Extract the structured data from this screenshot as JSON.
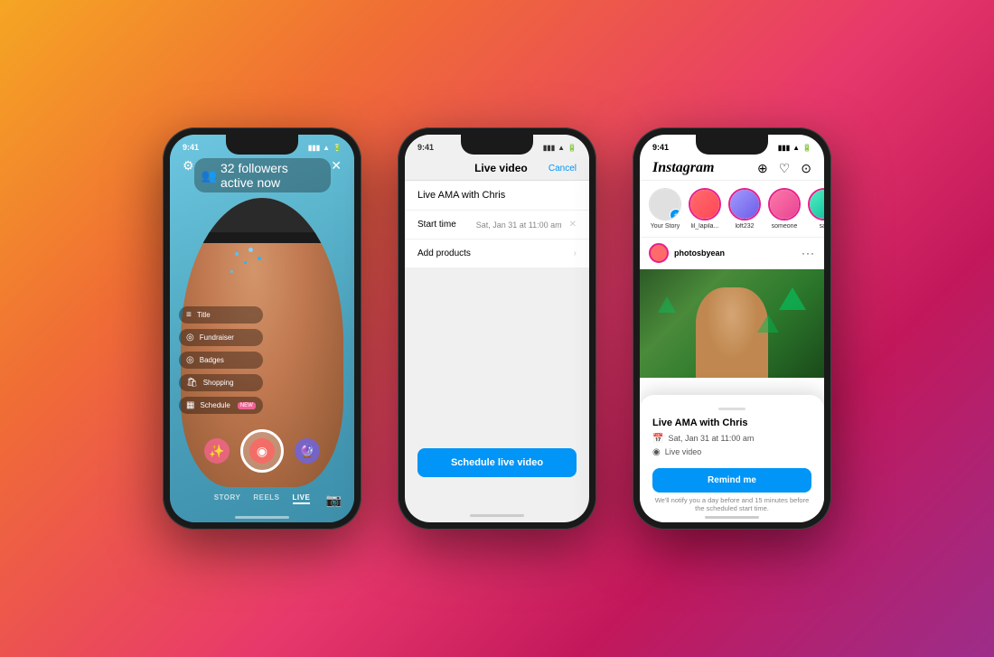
{
  "background": {
    "gradient": "linear-gradient(135deg, #f5a623 0%, #f06d35 25%, #e8396b 55%, #c2185b 75%, #9c2d8a 100%)"
  },
  "phone1": {
    "status_time": "9:41",
    "followers_text": "32 followers active now",
    "nav_items": [
      "STORY",
      "REELS",
      "LIVE"
    ],
    "active_nav": "LIVE",
    "menu_items": [
      {
        "icon": "≡",
        "label": "Title"
      },
      {
        "icon": "◎",
        "label": "Fundraiser"
      },
      {
        "icon": "◎",
        "label": "Badges"
      },
      {
        "icon": "◎",
        "label": "Shopping"
      },
      {
        "icon": "▦",
        "label": "Schedule",
        "new": true
      }
    ]
  },
  "phone2": {
    "status_time": "9:41",
    "header_title": "Live video",
    "header_cancel": "Cancel",
    "live_title": "Live AMA with Chris",
    "start_time_label": "Start time",
    "start_time_value": "Sat, Jan 31 at 11:00 am",
    "add_products_label": "Add products",
    "schedule_btn": "Schedule live video"
  },
  "phone3": {
    "status_time": "9:41",
    "insta_logo": "Instagram",
    "stories": [
      {
        "label": "Your Story",
        "type": "your"
      },
      {
        "label": "lil_lapila...",
        "color": "#e91e8c"
      },
      {
        "label": "loft232",
        "color": "#9c27b0"
      },
      {
        "label": "someone",
        "color": "#ff5722"
      },
      {
        "label": "sas",
        "color": "#2196f3"
      }
    ],
    "post_username": "photosbyean",
    "modal": {
      "title": "Live AMA with Chris",
      "date_icon": "📅",
      "date_text": "Sat, Jan 31 at 11:00 am",
      "live_icon": "◉",
      "live_text": "Live video",
      "remind_btn": "Remind me",
      "remind_note": "We'll notify you a day before and 15 minutes before the\nscheduled start time."
    }
  }
}
